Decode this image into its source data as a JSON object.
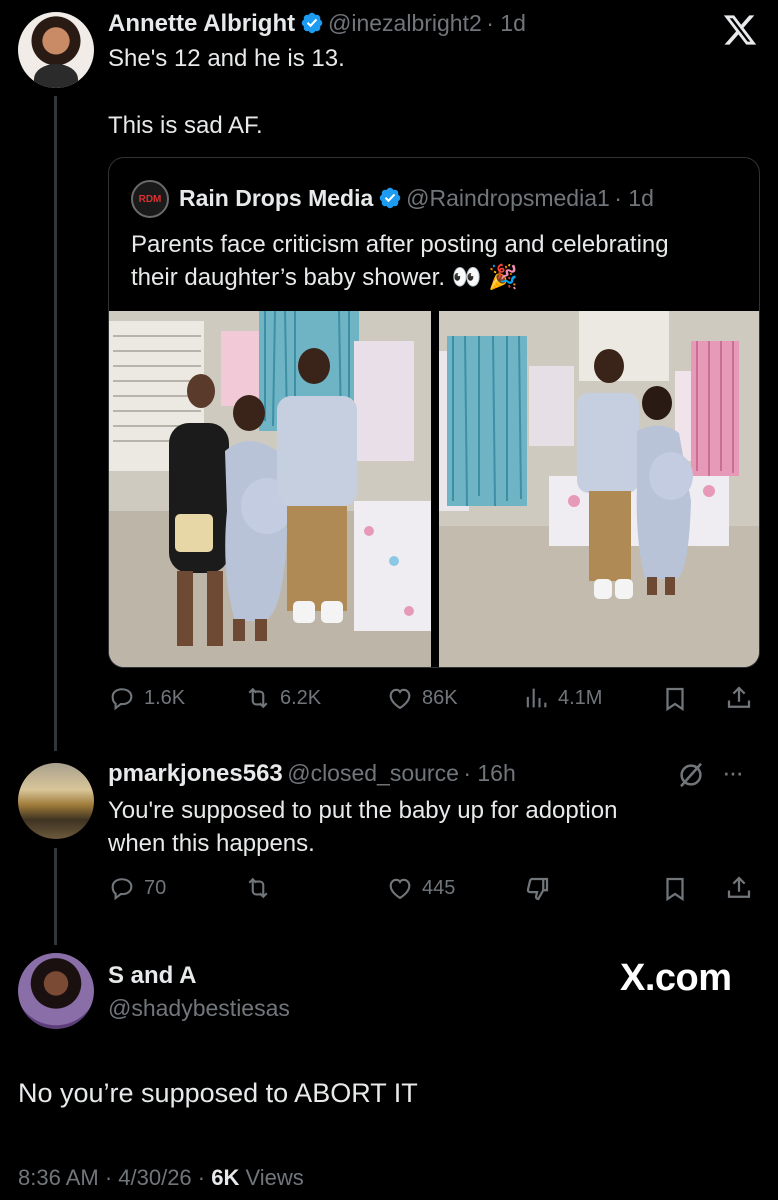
{
  "tweet1": {
    "display_name": "Annette Albright",
    "handle": "@inezalbright2",
    "time": "· 1d",
    "line1": "She's 12 and he is 13.",
    "line2": "This is sad AF.",
    "x_logo": "X"
  },
  "quote": {
    "logo_text": "RDM",
    "display_name": "Rain Drops Media",
    "handle": "@Raindropsmedia1",
    "time": "· 1d",
    "text_line1": "Parents face criticism after posting and celebrating",
    "text_line2": "their daughter’s baby shower. 👀 🎉"
  },
  "tweet1_stats": {
    "replies": "1.6K",
    "reposts": "6.2K",
    "likes": "86K",
    "views": "4.1M"
  },
  "tweet2": {
    "display_name": "pmarkjones563",
    "handle": "@closed_source",
    "time": "· 16h",
    "line1": "You're supposed to put the baby up for adoption",
    "line2": "when this happens.",
    "more": "···"
  },
  "tweet2_stats": {
    "replies": "70",
    "likes": "445"
  },
  "tweet3": {
    "display_name": "S and A",
    "handle": "@shadybestiesas",
    "watermark": "X.com",
    "text": "No you’re supposed to ABORT IT",
    "timestamp": "8:36 AM · 4/30/26 · ",
    "views_count": "6K",
    "views_label": "Views"
  },
  "colors": {
    "background": "#000000",
    "text": "#e7e9ea",
    "muted": "#71767b",
    "verified": "#1d9bf0"
  },
  "icons": [
    "x-close-icon",
    "verified-badge-icon",
    "reply-icon",
    "repost-icon",
    "like-icon",
    "views-icon",
    "bookmark-icon",
    "share-icon",
    "grok-icon",
    "more-icon",
    "dislike-icon"
  ]
}
